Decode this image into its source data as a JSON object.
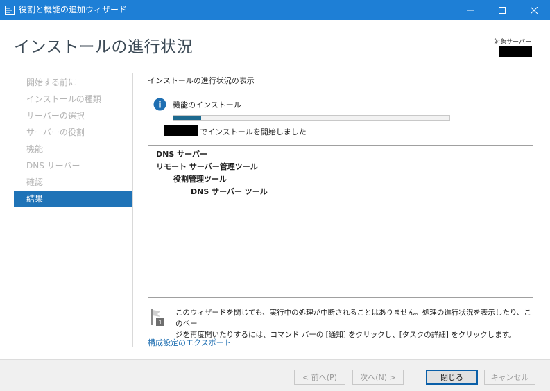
{
  "window": {
    "title": "役割と機能の追加ウィザード",
    "accent_color": "#1e7fd6"
  },
  "header": {
    "page_title": "インストールの進行状況",
    "target_server_label": "対象サーバー"
  },
  "nav": {
    "items": [
      {
        "label": "開始する前に",
        "state": "disabled"
      },
      {
        "label": "インストールの種類",
        "state": "disabled"
      },
      {
        "label": "サーバーの選択",
        "state": "disabled"
      },
      {
        "label": "サーバーの役割",
        "state": "disabled"
      },
      {
        "label": "機能",
        "state": "disabled"
      },
      {
        "label": "DNS サーバー",
        "state": "disabled"
      },
      {
        "label": "確認",
        "state": "disabled"
      },
      {
        "label": "結果",
        "state": "active"
      }
    ]
  },
  "content": {
    "section_title": "インストールの進行状況の表示",
    "feature_install_label": "機能のインストール",
    "progress_fraction": 0.1,
    "start_message": "でインストールを開始しました",
    "results": [
      {
        "label": "DNS サーバー",
        "level": 0
      },
      {
        "label": "リモート サーバー管理ツール",
        "level": 0
      },
      {
        "label": "役割管理ツール",
        "level": 1
      },
      {
        "label": "DNS サーバー ツール",
        "level": 2
      }
    ],
    "note_line1": "このウィザードを閉じても、実行中の処理が中断されることはありません。処理の進行状況を表示したり、このペー",
    "note_line2": "ジを再度開いたりするには、コマンド バーの [通知] をクリックし、[タスクの詳細] をクリックします。",
    "export_link": "構成設定のエクスポート"
  },
  "footer": {
    "prev_label": "< 前へ(P)",
    "next_label": "次へ(N) >",
    "close_label": "閉じる",
    "cancel_label": "キャンセル"
  }
}
